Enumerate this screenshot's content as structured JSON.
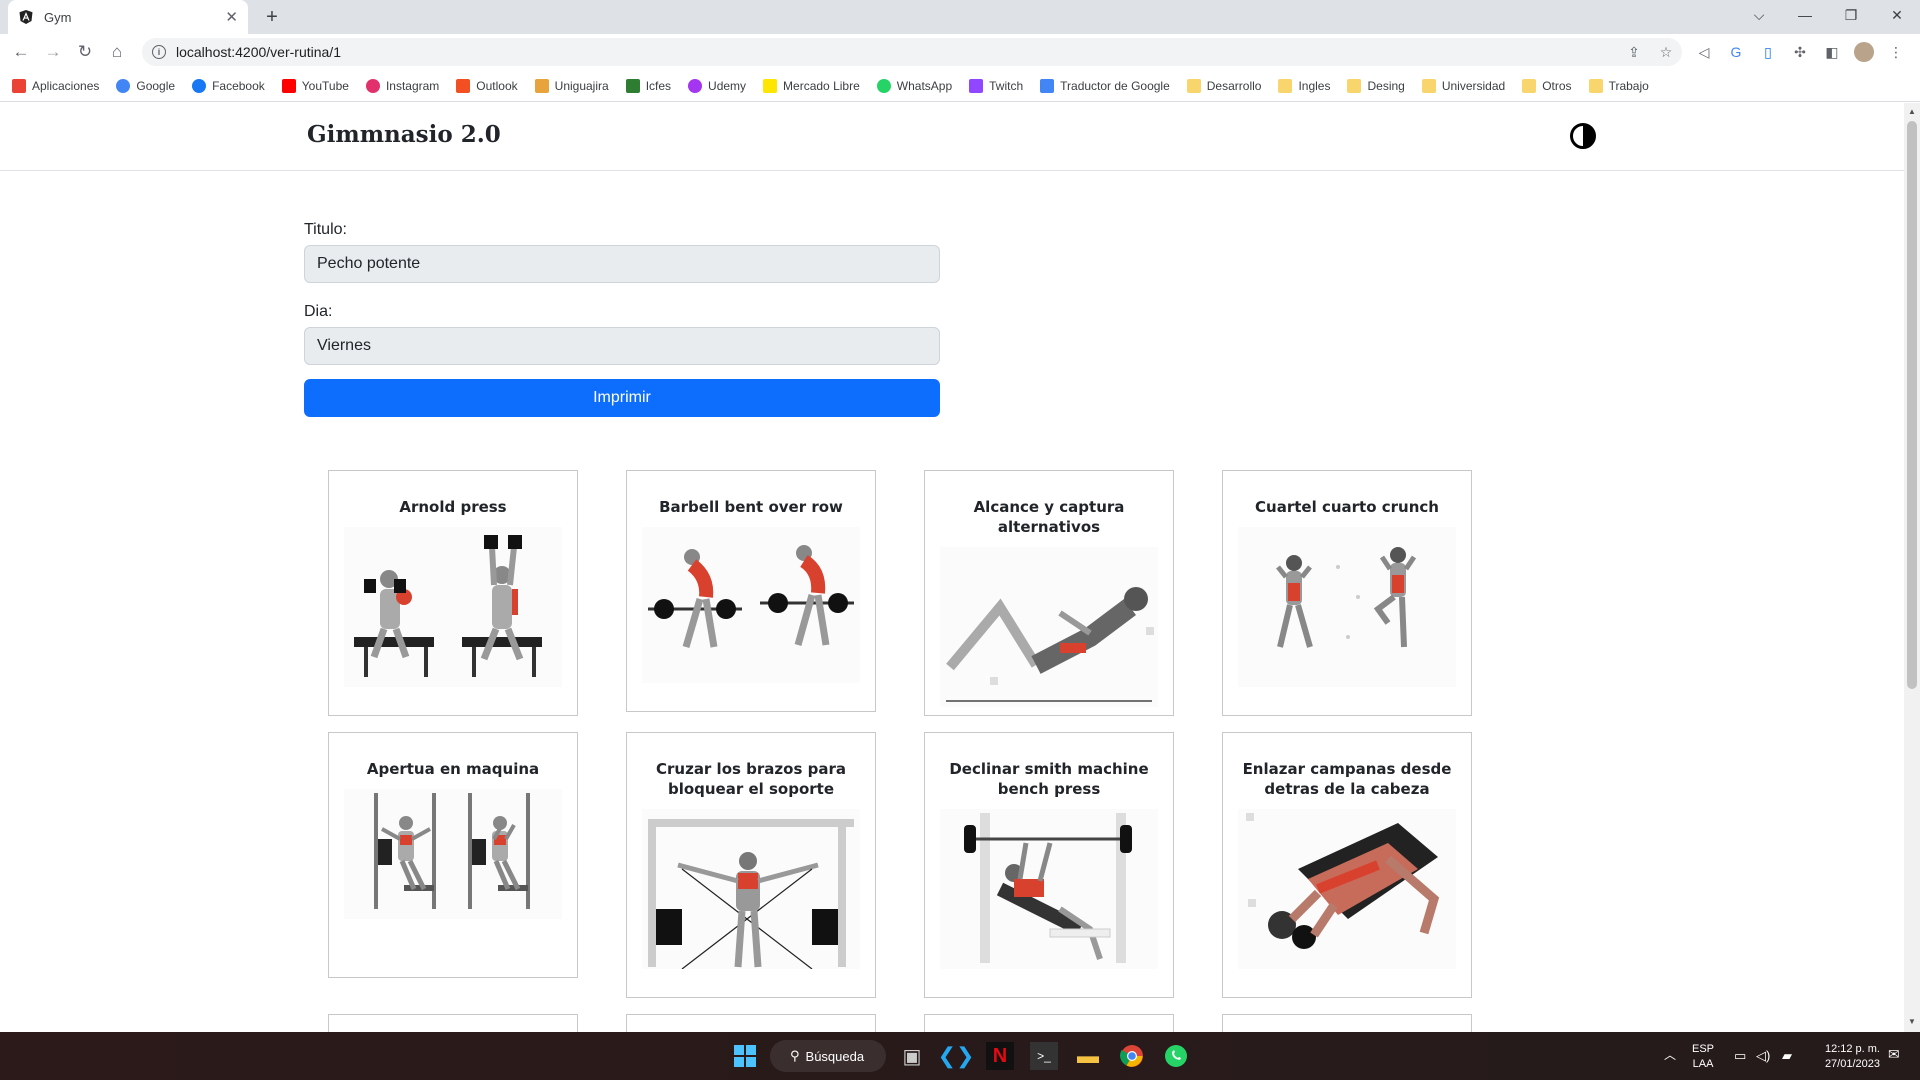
{
  "browser": {
    "tab_title": "Gym",
    "url": "localhost:4200/ver-rutina/1",
    "bookmarks": [
      {
        "label": "Aplicaciones",
        "icon": "apps-grid-icon",
        "color": "#ea4335"
      },
      {
        "label": "Google",
        "icon": "google-icon",
        "color": "#4285f4"
      },
      {
        "label": "Facebook",
        "icon": "facebook-icon",
        "color": "#1877f2"
      },
      {
        "label": "YouTube",
        "icon": "youtube-icon",
        "color": "#ff0000"
      },
      {
        "label": "Instagram",
        "icon": "instagram-icon",
        "color": "#e1306c"
      },
      {
        "label": "Outlook",
        "icon": "outlook-icon",
        "color": "#f25022"
      },
      {
        "label": "Uniguajira",
        "icon": "uniguajira-icon",
        "color": "#e8a33d"
      },
      {
        "label": "Icfes",
        "icon": "icfes-icon",
        "color": "#2e7d32"
      },
      {
        "label": "Udemy",
        "icon": "udemy-icon",
        "color": "#a435f0"
      },
      {
        "label": "Mercado Libre",
        "icon": "mercadolibre-icon",
        "color": "#ffe600"
      },
      {
        "label": "WhatsApp",
        "icon": "whatsapp-icon",
        "color": "#25d366"
      },
      {
        "label": "Twitch",
        "icon": "twitch-icon",
        "color": "#9146ff"
      },
      {
        "label": "Traductor de Google",
        "icon": "translate-icon",
        "color": "#4285f4"
      },
      {
        "label": "Desarrollo",
        "icon": "folder-icon",
        "color": "#f9d56e"
      },
      {
        "label": "Ingles",
        "icon": "folder-icon",
        "color": "#f9d56e"
      },
      {
        "label": "Desing",
        "icon": "folder-icon",
        "color": "#f9d56e"
      },
      {
        "label": "Universidad",
        "icon": "folder-icon",
        "color": "#f9d56e"
      },
      {
        "label": "Otros",
        "icon": "folder-icon",
        "color": "#f9d56e"
      },
      {
        "label": "Trabajo",
        "icon": "folder-icon",
        "color": "#f9d56e"
      }
    ]
  },
  "app": {
    "brand": "Gimmnasio 2.0",
    "form": {
      "titulo_label": "Titulo:",
      "titulo_value": "Pecho potente",
      "dia_label": "Dia:",
      "dia_value": "Viernes",
      "print_button": "Imprimir"
    },
    "exercises": [
      {
        "title": "Arnold press"
      },
      {
        "title": "Barbell bent over row"
      },
      {
        "title": "Alcance y captura alternativos"
      },
      {
        "title": "Cuartel cuarto crunch"
      },
      {
        "title": "Apertua en maquina"
      },
      {
        "title": "Cruzar los brazos para bloquear el soporte"
      },
      {
        "title": "Declinar smith machine bench press"
      },
      {
        "title": "Enlazar campanas desde detras de la cabeza"
      }
    ],
    "colors": {
      "primary": "#0d6efd",
      "muscle_highlight": "#d9412f"
    }
  },
  "taskbar": {
    "search_label": "Búsqueda",
    "lang_top": "ESP",
    "lang_bottom": "LAA",
    "time": "12:12 p. m.",
    "date": "27/01/2023"
  }
}
